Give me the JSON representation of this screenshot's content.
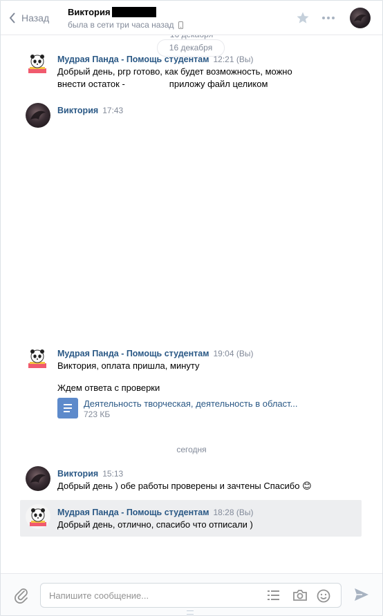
{
  "header": {
    "back_label": "Назад",
    "peer_name": "Виктория",
    "peer_status": "была в сети три часа назад"
  },
  "history": {
    "date_ghost": "16 декабря",
    "date_pill": "16 декабря",
    "today_label": "сегодня"
  },
  "messages": [
    {
      "author": "Мудрая Панда - Помощь студентам",
      "time": "12:21",
      "you_suffix": "(Вы)",
      "line1": "Добрый день, ргр готово, как будет возможность, можно",
      "line2": "внести остаток -",
      "line2b": "приложу файл целиком"
    },
    {
      "author": "Виктория",
      "time": "17:43"
    },
    {
      "author": "Мудрая Панда - Помощь студентам",
      "time": "19:04",
      "you_suffix": "(Вы)",
      "line1": "Виктория, оплата пришла, минуту",
      "line2": "Ждем ответа с проверки",
      "doc_title": "Деятельность творческая, деятельность в област...",
      "doc_size": "723 КБ"
    },
    {
      "author": "Виктория",
      "time": "15:13",
      "text": "Добрый день ) обе работы проверены и зачтены Спасибо",
      "emoji": "😊"
    },
    {
      "author": "Мудрая Панда - Помощь студентам",
      "time": "18:28",
      "you_suffix": "(Вы)",
      "text": "Добрый день, отлично, спасибо что отписали )"
    }
  ],
  "composer": {
    "placeholder": "Напишите сообщение..."
  },
  "colors": {
    "link": "#2a5885",
    "muted": "#828a99",
    "accent": "#5d8acb",
    "highlight": "#edeef0"
  }
}
